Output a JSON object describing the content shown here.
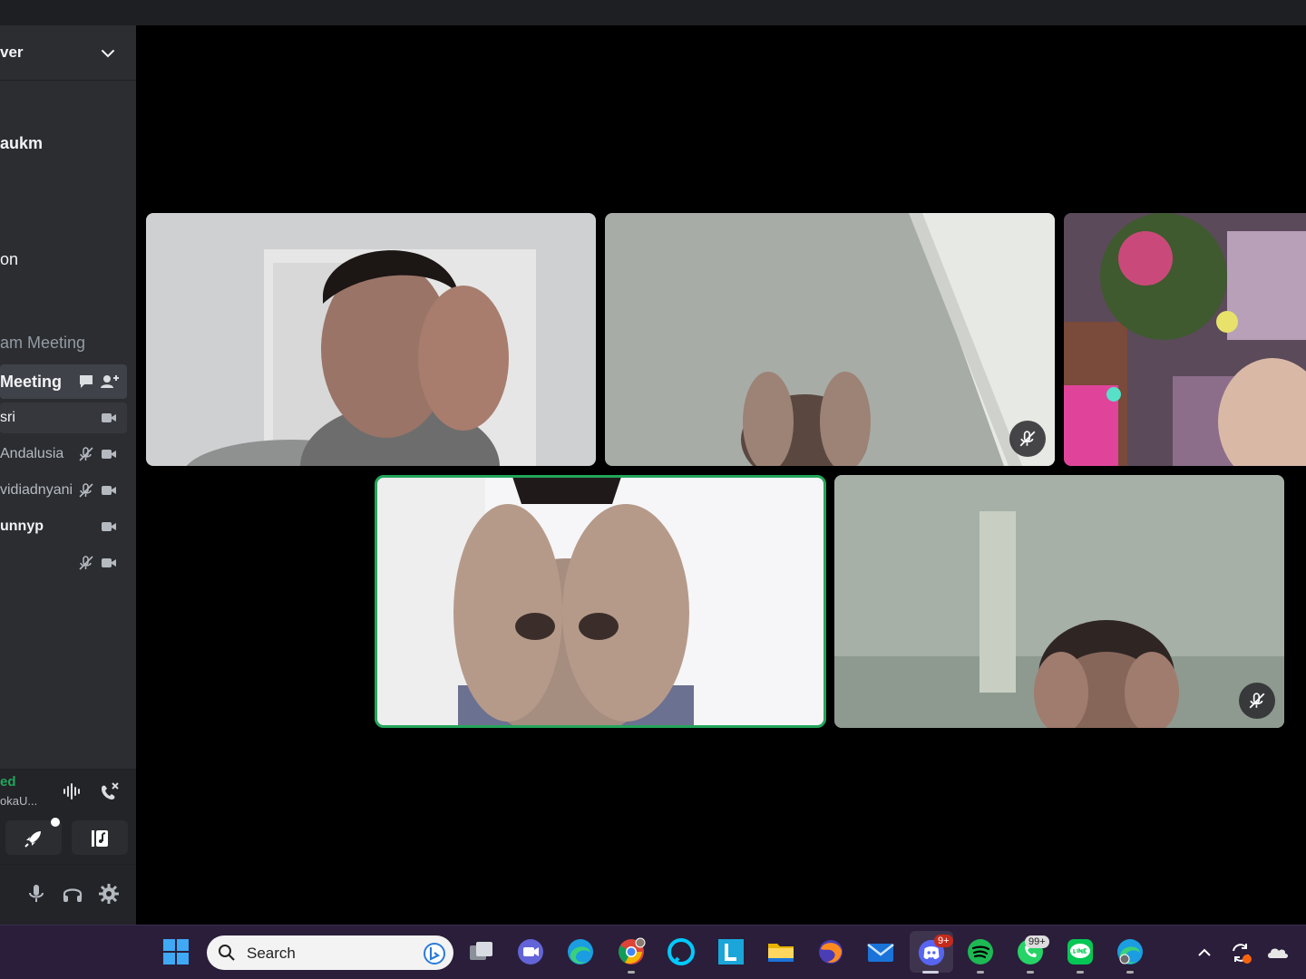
{
  "sidebar": {
    "server_name": "ver",
    "channels": [
      {
        "label": "aukm"
      },
      {
        "label": "on"
      },
      {
        "label": "am Meeting"
      }
    ],
    "active_channel": {
      "label": "Meeting"
    },
    "members": [
      {
        "name": "sri",
        "muted": false
      },
      {
        "name": "Andalusia",
        "muted": true
      },
      {
        "name": "vidiadnyani",
        "muted": true
      },
      {
        "name": "unnyp",
        "muted": false
      },
      {
        "name": "",
        "muted": true
      }
    ],
    "voice": {
      "status": "ed",
      "channel": "okaU..."
    }
  },
  "taskbar": {
    "search_label": "Search",
    "discord_badge": "9+",
    "whatsapp_badge": "99+"
  },
  "colors": {
    "connected_green": "#23a55a",
    "sidebar_bg": "#2b2d31",
    "taskbar_bg": "#2a1e3a"
  },
  "icons": [
    "chevron-down-icon",
    "chat-icon",
    "add-member-icon",
    "camera-icon",
    "mic-muted-icon",
    "soundboard-icon",
    "disconnect-icon",
    "rocket-icon",
    "music-icon",
    "mic-icon",
    "headphones-icon",
    "gear-icon",
    "windows-start-icon",
    "search-icon",
    "bing-icon"
  ]
}
